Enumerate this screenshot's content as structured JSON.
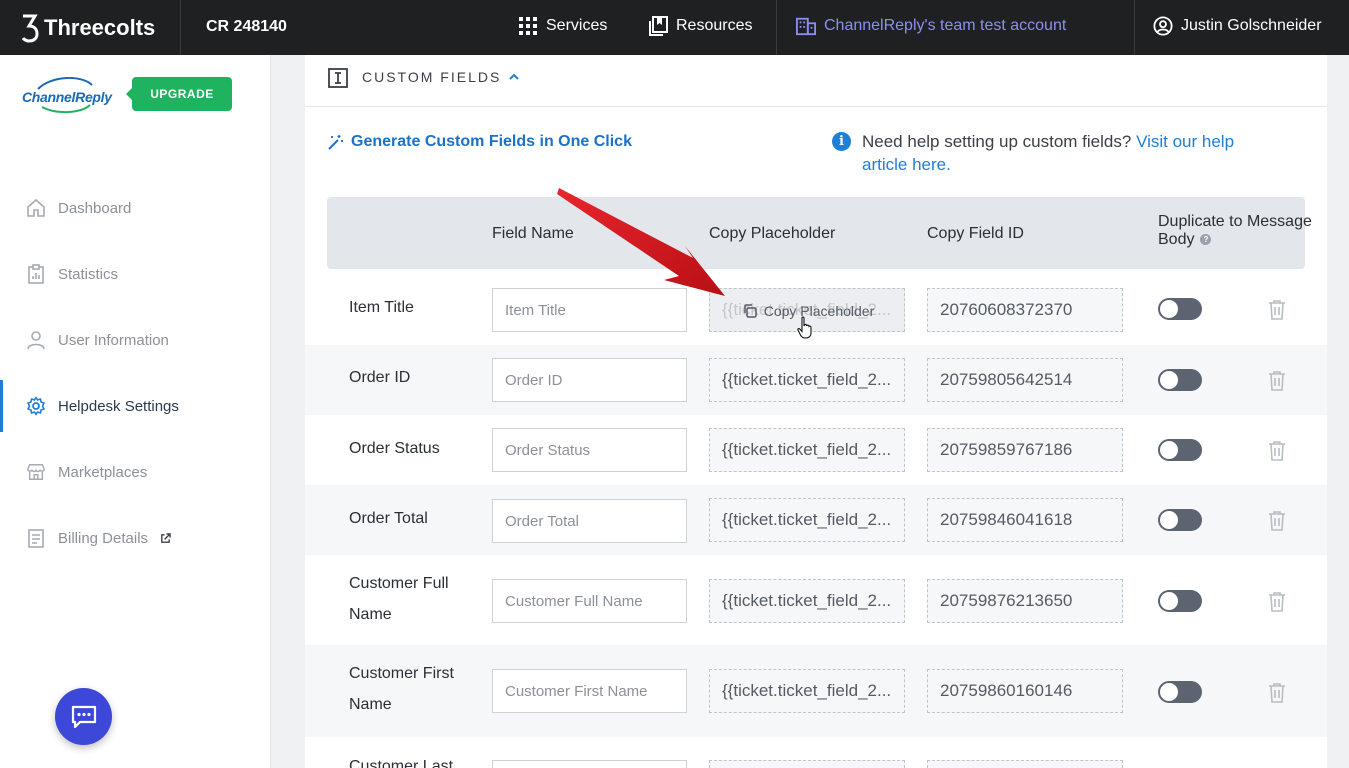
{
  "topbar": {
    "brand": "Threecolts",
    "account_code": "CR 248140",
    "services": "Services",
    "resources": "Resources",
    "team_account": "ChannelReply's team test account",
    "user_name": "Justin Golschneider"
  },
  "sidebar": {
    "logo_text": "ChannelReply",
    "upgrade": "UPGRADE",
    "items": [
      {
        "label": "Dashboard",
        "icon": "home-icon"
      },
      {
        "label": "Statistics",
        "icon": "clipboard-chart-icon"
      },
      {
        "label": "User Information",
        "icon": "user-icon"
      },
      {
        "label": "Helpdesk Settings",
        "icon": "gear-icon",
        "active": true
      },
      {
        "label": "Marketplaces",
        "icon": "store-icon"
      },
      {
        "label": "Billing Details",
        "icon": "billing-icon"
      }
    ]
  },
  "section": {
    "title": "CUSTOM FIELDS",
    "generate_link": "Generate Custom Fields in One Click",
    "help_text": "Need help setting up custom fields? ",
    "help_link": "Visit our help article here."
  },
  "table": {
    "headers": {
      "field_name": "Field Name",
      "copy_placeholder": "Copy Placeholder",
      "copy_field_id": "Copy Field ID",
      "duplicate": "Duplicate to Message Body"
    },
    "hover_label": "Copy Placeholder",
    "hover_faded_text": "{{ticket.ticket_field_2...",
    "rows": [
      {
        "label": "Item Title",
        "placeholder": "Item Title",
        "placeholder_code": "{{ticket.ticket_field_2...",
        "field_id": "20760608372370"
      },
      {
        "label": "Order ID",
        "placeholder": "Order ID",
        "placeholder_code": "{{ticket.ticket_field_2...",
        "field_id": "20759805642514"
      },
      {
        "label": "Order Status",
        "placeholder": "Order Status",
        "placeholder_code": "{{ticket.ticket_field_2...",
        "field_id": "20759859767186"
      },
      {
        "label": "Order Total",
        "placeholder": "Order Total",
        "placeholder_code": "{{ticket.ticket_field_2...",
        "field_id": "20759846041618"
      },
      {
        "label": "Customer Full Name",
        "placeholder": "Customer Full Name",
        "placeholder_code": "{{ticket.ticket_field_2...",
        "field_id": "20759876213650"
      },
      {
        "label": "Customer First Name",
        "placeholder": "Customer First Name",
        "placeholder_code": "{{ticket.ticket_field_2...",
        "field_id": "20759860160146"
      },
      {
        "label": "Customer Last",
        "placeholder": "",
        "placeholder_code": "",
        "field_id": ""
      }
    ]
  },
  "colors": {
    "accent": "#1f7fd6",
    "upgrade_green": "#1fb360",
    "annotation_red": "#d4141b",
    "chat_button": "#3d47d8"
  }
}
